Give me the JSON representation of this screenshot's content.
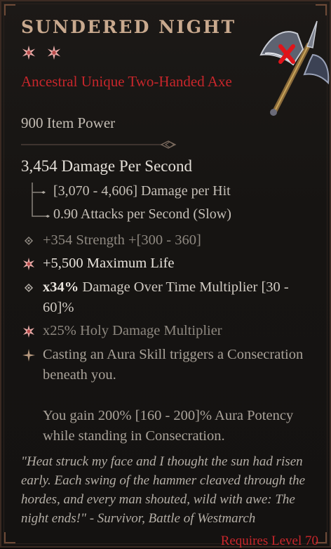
{
  "item": {
    "name": "SUNDERED NIGHT",
    "rarity_type": "Ancestral Unique Two-Handed Axe",
    "item_power": "900 Item Power",
    "icon": "two-handed-axe-icon",
    "stars": [
      "star-icon",
      "star-icon"
    ],
    "stars_color": "#e8a9a6"
  },
  "stats": {
    "dps": "3,454 Damage Per Second",
    "damage_per_hit": "[3,070 - 4,606] Damage per Hit",
    "attack_speed": "0.90 Attacks per Second (Slow)"
  },
  "affixes": [
    {
      "text": "+354 Strength +[300 - 360]",
      "icon": "diamond-icon"
    },
    {
      "text": "+5,500 Maximum Life",
      "icon": "star-burst-icon"
    },
    {
      "value": "x34%",
      "rest": " Damage Over Time Multiplier [30 - 60]%",
      "icon": "diamond-icon"
    },
    {
      "text": "x25% Holy Damage Multiplier",
      "icon": "star-burst-icon"
    }
  ],
  "unique": {
    "icon": "unique-spark-icon",
    "line1": "Casting an Aura Skill triggers a Consecration beneath you.",
    "line2": "You gain 200% [160 - 200]% Aura Potency while standing in Consecration."
  },
  "flavor": "\"Heat struck my face and I thought the sun had risen early. Each swing of the hammer cleaved through the hordes, and every man shouted, wild with awe: The night ends!\" - Survivor, Battle of Westmarch",
  "requirement": "Requires Level 70",
  "colors": {
    "title": "#c9a98e",
    "rarity": "#c8262b",
    "background": "#161412",
    "requirement": "#c8262b"
  }
}
